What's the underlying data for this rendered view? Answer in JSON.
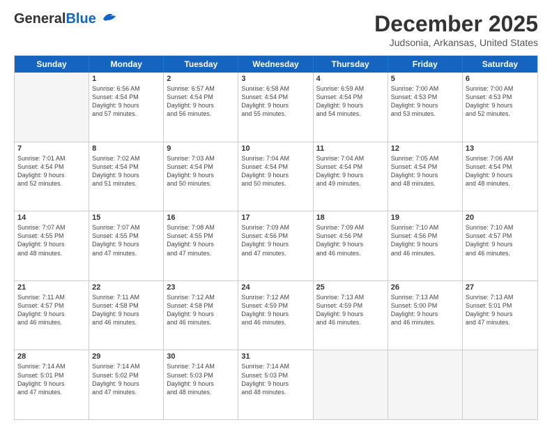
{
  "logo": {
    "line1": "General",
    "line2": "Blue"
  },
  "title": "December 2025",
  "subtitle": "Judsonia, Arkansas, United States",
  "headers": [
    "Sunday",
    "Monday",
    "Tuesday",
    "Wednesday",
    "Thursday",
    "Friday",
    "Saturday"
  ],
  "rows": [
    [
      {
        "day": "",
        "lines": [],
        "empty": true
      },
      {
        "day": "1",
        "lines": [
          "Sunrise: 6:56 AM",
          "Sunset: 4:54 PM",
          "Daylight: 9 hours",
          "and 57 minutes."
        ]
      },
      {
        "day": "2",
        "lines": [
          "Sunrise: 6:57 AM",
          "Sunset: 4:54 PM",
          "Daylight: 9 hours",
          "and 56 minutes."
        ]
      },
      {
        "day": "3",
        "lines": [
          "Sunrise: 6:58 AM",
          "Sunset: 4:54 PM",
          "Daylight: 9 hours",
          "and 55 minutes."
        ]
      },
      {
        "day": "4",
        "lines": [
          "Sunrise: 6:59 AM",
          "Sunset: 4:54 PM",
          "Daylight: 9 hours",
          "and 54 minutes."
        ]
      },
      {
        "day": "5",
        "lines": [
          "Sunrise: 7:00 AM",
          "Sunset: 4:53 PM",
          "Daylight: 9 hours",
          "and 53 minutes."
        ]
      },
      {
        "day": "6",
        "lines": [
          "Sunrise: 7:00 AM",
          "Sunset: 4:53 PM",
          "Daylight: 9 hours",
          "and 52 minutes."
        ]
      }
    ],
    [
      {
        "day": "7",
        "lines": [
          "Sunrise: 7:01 AM",
          "Sunset: 4:54 PM",
          "Daylight: 9 hours",
          "and 52 minutes."
        ]
      },
      {
        "day": "8",
        "lines": [
          "Sunrise: 7:02 AM",
          "Sunset: 4:54 PM",
          "Daylight: 9 hours",
          "and 51 minutes."
        ]
      },
      {
        "day": "9",
        "lines": [
          "Sunrise: 7:03 AM",
          "Sunset: 4:54 PM",
          "Daylight: 9 hours",
          "and 50 minutes."
        ]
      },
      {
        "day": "10",
        "lines": [
          "Sunrise: 7:04 AM",
          "Sunset: 4:54 PM",
          "Daylight: 9 hours",
          "and 50 minutes."
        ]
      },
      {
        "day": "11",
        "lines": [
          "Sunrise: 7:04 AM",
          "Sunset: 4:54 PM",
          "Daylight: 9 hours",
          "and 49 minutes."
        ]
      },
      {
        "day": "12",
        "lines": [
          "Sunrise: 7:05 AM",
          "Sunset: 4:54 PM",
          "Daylight: 9 hours",
          "and 48 minutes."
        ]
      },
      {
        "day": "13",
        "lines": [
          "Sunrise: 7:06 AM",
          "Sunset: 4:54 PM",
          "Daylight: 9 hours",
          "and 48 minutes."
        ]
      }
    ],
    [
      {
        "day": "14",
        "lines": [
          "Sunrise: 7:07 AM",
          "Sunset: 4:55 PM",
          "Daylight: 9 hours",
          "and 48 minutes."
        ]
      },
      {
        "day": "15",
        "lines": [
          "Sunrise: 7:07 AM",
          "Sunset: 4:55 PM",
          "Daylight: 9 hours",
          "and 47 minutes."
        ]
      },
      {
        "day": "16",
        "lines": [
          "Sunrise: 7:08 AM",
          "Sunset: 4:55 PM",
          "Daylight: 9 hours",
          "and 47 minutes."
        ]
      },
      {
        "day": "17",
        "lines": [
          "Sunrise: 7:09 AM",
          "Sunset: 4:56 PM",
          "Daylight: 9 hours",
          "and 47 minutes."
        ]
      },
      {
        "day": "18",
        "lines": [
          "Sunrise: 7:09 AM",
          "Sunset: 4:56 PM",
          "Daylight: 9 hours",
          "and 46 minutes."
        ]
      },
      {
        "day": "19",
        "lines": [
          "Sunrise: 7:10 AM",
          "Sunset: 4:56 PM",
          "Daylight: 9 hours",
          "and 46 minutes."
        ]
      },
      {
        "day": "20",
        "lines": [
          "Sunrise: 7:10 AM",
          "Sunset: 4:57 PM",
          "Daylight: 9 hours",
          "and 46 minutes."
        ]
      }
    ],
    [
      {
        "day": "21",
        "lines": [
          "Sunrise: 7:11 AM",
          "Sunset: 4:57 PM",
          "Daylight: 9 hours",
          "and 46 minutes."
        ]
      },
      {
        "day": "22",
        "lines": [
          "Sunrise: 7:11 AM",
          "Sunset: 4:58 PM",
          "Daylight: 9 hours",
          "and 46 minutes."
        ]
      },
      {
        "day": "23",
        "lines": [
          "Sunrise: 7:12 AM",
          "Sunset: 4:58 PM",
          "Daylight: 9 hours",
          "and 46 minutes."
        ]
      },
      {
        "day": "24",
        "lines": [
          "Sunrise: 7:12 AM",
          "Sunset: 4:59 PM",
          "Daylight: 9 hours",
          "and 46 minutes."
        ]
      },
      {
        "day": "25",
        "lines": [
          "Sunrise: 7:13 AM",
          "Sunset: 4:59 PM",
          "Daylight: 9 hours",
          "and 46 minutes."
        ]
      },
      {
        "day": "26",
        "lines": [
          "Sunrise: 7:13 AM",
          "Sunset: 5:00 PM",
          "Daylight: 9 hours",
          "and 46 minutes."
        ]
      },
      {
        "day": "27",
        "lines": [
          "Sunrise: 7:13 AM",
          "Sunset: 5:01 PM",
          "Daylight: 9 hours",
          "and 47 minutes."
        ]
      }
    ],
    [
      {
        "day": "28",
        "lines": [
          "Sunrise: 7:14 AM",
          "Sunset: 5:01 PM",
          "Daylight: 9 hours",
          "and 47 minutes."
        ]
      },
      {
        "day": "29",
        "lines": [
          "Sunrise: 7:14 AM",
          "Sunset: 5:02 PM",
          "Daylight: 9 hours",
          "and 47 minutes."
        ]
      },
      {
        "day": "30",
        "lines": [
          "Sunrise: 7:14 AM",
          "Sunset: 5:03 PM",
          "Daylight: 9 hours",
          "and 48 minutes."
        ]
      },
      {
        "day": "31",
        "lines": [
          "Sunrise: 7:14 AM",
          "Sunset: 5:03 PM",
          "Daylight: 9 hours",
          "and 48 minutes."
        ]
      },
      {
        "day": "",
        "lines": [],
        "empty": true
      },
      {
        "day": "",
        "lines": [],
        "empty": true
      },
      {
        "day": "",
        "lines": [],
        "empty": true
      }
    ]
  ]
}
